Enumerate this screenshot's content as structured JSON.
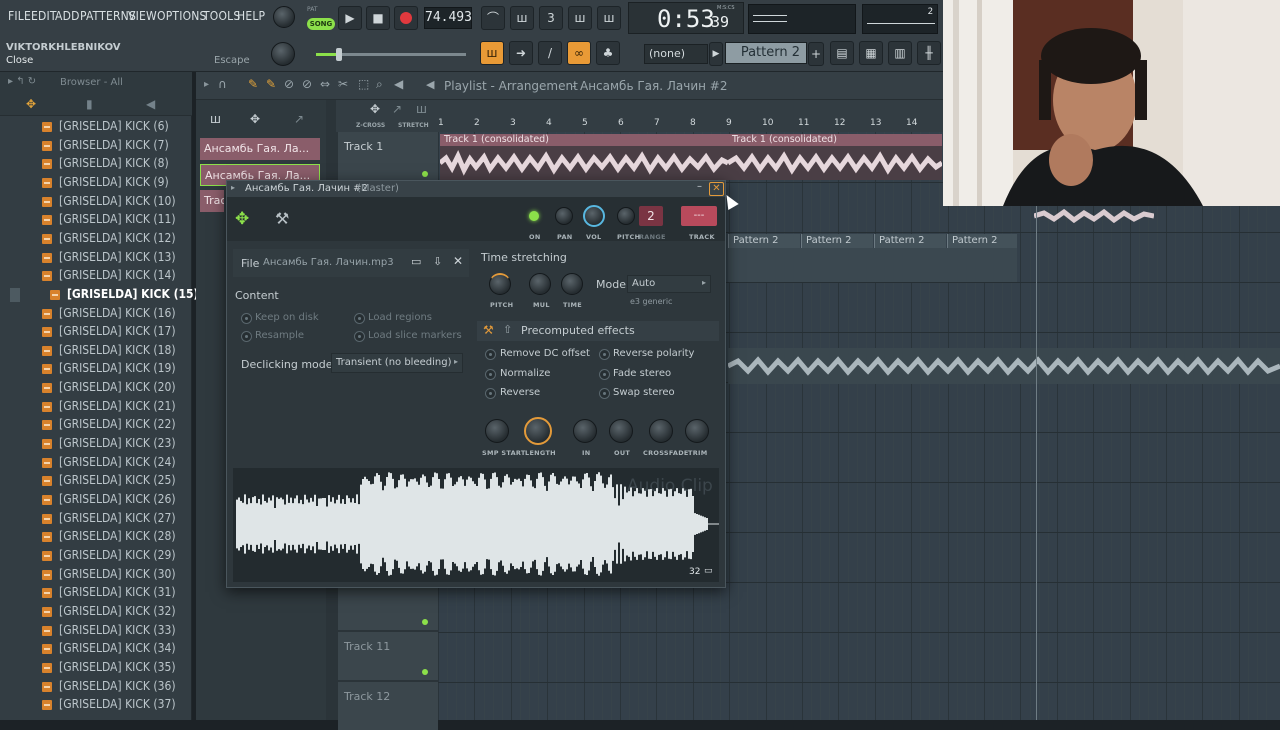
{
  "menu": [
    "FILE",
    "EDIT",
    "ADD",
    "PATTERNS",
    "VIEW",
    "OPTIONS",
    "TOOLS",
    "HELP"
  ],
  "transport": {
    "pat_label": "PAT",
    "song_label": "SONG",
    "tempo": "74.493",
    "time_main": "0:53",
    "time_sub": "39",
    "time_unit": "M:S:CS",
    "small_lcd_value": "2"
  },
  "user": {
    "name": "VIKTORKHLEBNIKOV",
    "hint_left": "Close",
    "hint_right": "Escape"
  },
  "toolbar": {
    "snap": "(none)",
    "pattern": "Pattern 2",
    "add": "+"
  },
  "browser": {
    "title": "Browser - All",
    "items": [
      "[GRISELDA] KICK (6)",
      "[GRISELDA] KICK (7)",
      "[GRISELDA] KICK (8)",
      "[GRISELDA] KICK (9)",
      "[GRISELDA] KICK (10)",
      "[GRISELDA] KICK (11)",
      "[GRISELDA] KICK (12)",
      "[GRISELDA] KICK (13)",
      "[GRISELDA] KICK (14)",
      "[GRISELDA] KICK (15)",
      "[GRISELDA] KICK (16)",
      "[GRISELDA] KICK (17)",
      "[GRISELDA] KICK (18)",
      "[GRISELDA] KICK (19)",
      "[GRISELDA] KICK (20)",
      "[GRISELDA] KICK (21)",
      "[GRISELDA] KICK (22)",
      "[GRISELDA] KICK (23)",
      "[GRISELDA] KICK (24)",
      "[GRISELDA] KICK (25)",
      "[GRISELDA] KICK (26)",
      "[GRISELDA] KICK (27)",
      "[GRISELDA] KICK (28)",
      "[GRISELDA] KICK (29)",
      "[GRISELDA] KICK (30)",
      "[GRISELDA] KICK (31)",
      "[GRISELDA] KICK (32)",
      "[GRISELDA] KICK (33)",
      "[GRISELDA] KICK (34)",
      "[GRISELDA] KICK (35)",
      "[GRISELDA] KICK (36)",
      "[GRISELDA] KICK (37)"
    ],
    "selected_index": 9
  },
  "playlist": {
    "title": "Playlist - Arrangement",
    "breadcrumb_current": "Ансамбь Гая. Лачин #2",
    "zcross": "Z-CROSS",
    "stretch": "STRETCH",
    "bar_numbers": [
      "1",
      "2",
      "3",
      "4",
      "5",
      "6",
      "7",
      "8",
      "9",
      "10",
      "11",
      "12",
      "13",
      "14"
    ],
    "picker_clips": [
      "Ансамбь Гая. Ла...",
      "Ансамбь Гая. Ла...",
      "Trac"
    ],
    "track1": "Track 1",
    "track11": "Track 11",
    "track12": "Track 12",
    "clip_label": "Track 1 (consolidated)",
    "pattern_blocks": [
      "Pattern 2",
      "Pattern 2",
      "Pattern 2",
      "Pattern 2"
    ]
  },
  "clip_window": {
    "title": "Ансамбь Гая. Лачин #2",
    "title_suffix": "(Master)",
    "knob_labels": [
      "ON",
      "PAN",
      "VOL",
      "PITCH",
      "RANGE",
      "TRACK"
    ],
    "range_value": "2",
    "track_value": "---",
    "file_label": "File",
    "file_name": "Ансамбь Гая. Лачин.mp3",
    "content_label": "Content",
    "keep_on_disk": "Keep on disk",
    "resample": "Resample",
    "load_regions": "Load regions",
    "load_slice_markers": "Load slice markers",
    "declicking_label": "Declicking mode",
    "declicking_value": "Transient (no bleeding)",
    "time_stretching": "Time stretching",
    "ts_knobs": [
      "PITCH",
      "MUL",
      "TIME"
    ],
    "mode_label": "Mode",
    "mode_value": "Auto",
    "mode_sub": "e3 generic",
    "precomputed": "Precomputed effects",
    "effects_left": [
      "Remove DC offset",
      "Normalize",
      "Reverse"
    ],
    "effects_right": [
      "Reverse polarity",
      "Fade stereo",
      "Swap stereo"
    ],
    "bottom_knobs": [
      "SMP START",
      "LENGTH",
      "IN",
      "OUT",
      "CROSSFADE",
      "TRIM"
    ],
    "watermark": "Audio Clip",
    "wave_count": "32"
  },
  "colors": {
    "accent": "#8ce04a",
    "orange": "#f0a030",
    "clip_pink": "#8a5d6a"
  }
}
